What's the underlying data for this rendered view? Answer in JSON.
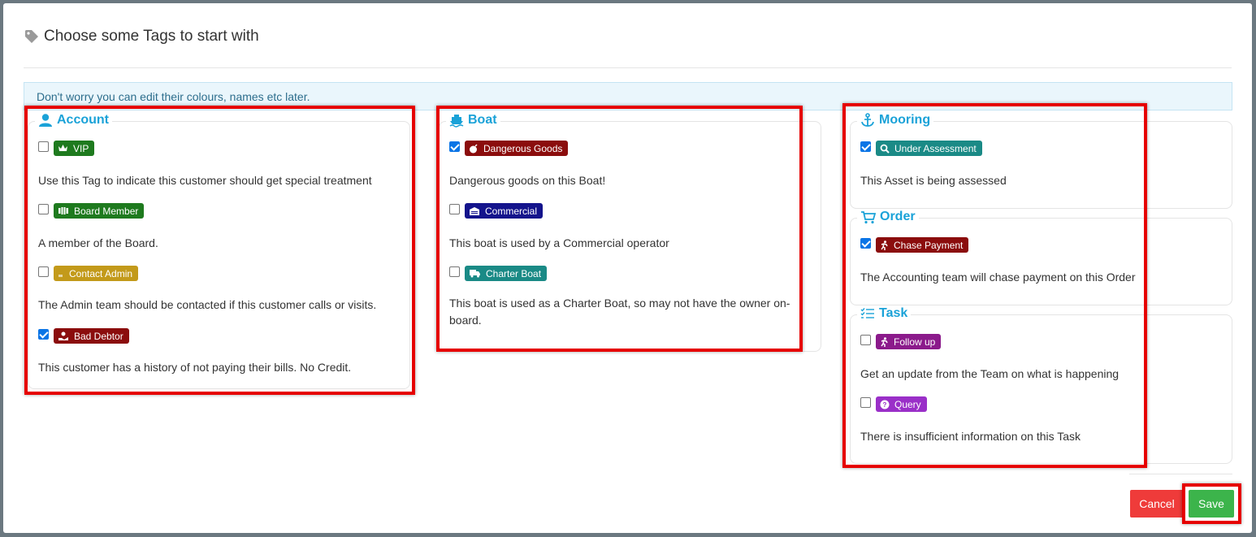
{
  "modal": {
    "title": "Choose some Tags to start with"
  },
  "info": "Don't worry you can edit their colours, names etc later.",
  "groups": {
    "account": {
      "title": "Account",
      "tags": [
        {
          "label": "VIP",
          "checked": false,
          "color": "#1e7a1e",
          "icon": "crown-icon",
          "description": "Use this Tag to indicate this customer should get special treatment"
        },
        {
          "label": "Board Member",
          "checked": false,
          "color": "#1e7a1e",
          "icon": "dumbbell-icon",
          "description": "A member of the Board."
        },
        {
          "label": "Contact Admin",
          "checked": false,
          "color": "#c39a1a",
          "icon": "phone-icon",
          "description": "The Admin team should be contacted if this customer calls or visits."
        },
        {
          "label": "Bad Debtor",
          "checked": true,
          "color": "#8b0d0d",
          "icon": "hand-money-icon",
          "description": "This customer has a history of not paying their bills. No Credit."
        }
      ]
    },
    "boat": {
      "title": "Boat",
      "tags": [
        {
          "label": "Dangerous Goods",
          "checked": true,
          "color": "#8b0d0d",
          "icon": "bomb-icon",
          "description": "Dangerous goods on this Boat!"
        },
        {
          "label": "Commercial",
          "checked": false,
          "color": "#14148c",
          "icon": "warehouse-icon",
          "description": "This boat is used by a Commercial operator"
        },
        {
          "label": "Charter Boat",
          "checked": false,
          "color": "#1a8a86",
          "icon": "truck-icon",
          "description": "This boat is used as a Charter Boat, so may not have the owner on-board."
        }
      ]
    },
    "mooring": {
      "title": "Mooring",
      "tags": [
        {
          "label": "Under Assessment",
          "checked": true,
          "color": "#1a8a86",
          "icon": "search-icon",
          "description": "This Asset is being assessed"
        }
      ]
    },
    "order": {
      "title": "Order",
      "tags": [
        {
          "label": "Chase Payment",
          "checked": true,
          "color": "#8b0d0d",
          "icon": "running-icon",
          "description": "The Accounting team will chase payment on this Order"
        }
      ]
    },
    "task": {
      "title": "Task",
      "tags": [
        {
          "label": "Follow up",
          "checked": false,
          "color": "#8b1a8b",
          "icon": "running-icon",
          "description": "Get an update from the Team on what is happening"
        },
        {
          "label": "Query",
          "checked": false,
          "color": "#9a2fc8",
          "icon": "question-circle-icon",
          "description": "There is insufficient information on this Task"
        }
      ]
    }
  },
  "buttons": {
    "cancel": "Cancel",
    "save": "Save"
  },
  "colors": {
    "accent": "#1aa2d8",
    "cancel": "#ef3b3a",
    "save": "#3cb44b",
    "highlight": "#e60000"
  }
}
